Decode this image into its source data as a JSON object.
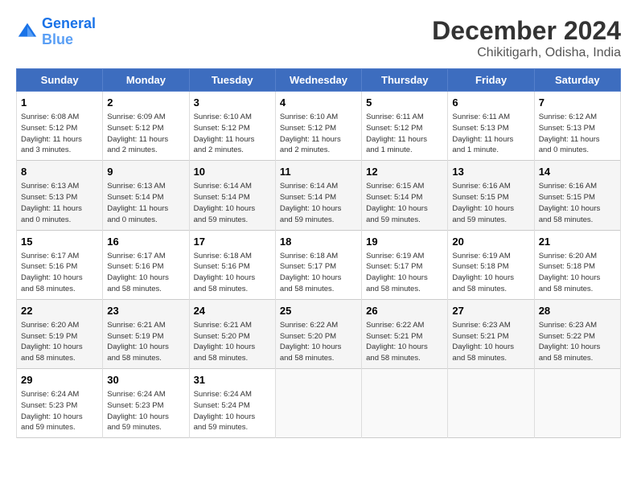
{
  "logo": {
    "line1": "General",
    "line2": "Blue"
  },
  "title": "December 2024",
  "subtitle": "Chikitigarh, Odisha, India",
  "weekdays": [
    "Sunday",
    "Monday",
    "Tuesday",
    "Wednesday",
    "Thursday",
    "Friday",
    "Saturday"
  ],
  "weeks": [
    [
      {
        "day": 1,
        "info": "Sunrise: 6:08 AM\nSunset: 5:12 PM\nDaylight: 11 hours\nand 3 minutes."
      },
      {
        "day": 2,
        "info": "Sunrise: 6:09 AM\nSunset: 5:12 PM\nDaylight: 11 hours\nand 2 minutes."
      },
      {
        "day": 3,
        "info": "Sunrise: 6:10 AM\nSunset: 5:12 PM\nDaylight: 11 hours\nand 2 minutes."
      },
      {
        "day": 4,
        "info": "Sunrise: 6:10 AM\nSunset: 5:12 PM\nDaylight: 11 hours\nand 2 minutes."
      },
      {
        "day": 5,
        "info": "Sunrise: 6:11 AM\nSunset: 5:12 PM\nDaylight: 11 hours\nand 1 minute."
      },
      {
        "day": 6,
        "info": "Sunrise: 6:11 AM\nSunset: 5:13 PM\nDaylight: 11 hours\nand 1 minute."
      },
      {
        "day": 7,
        "info": "Sunrise: 6:12 AM\nSunset: 5:13 PM\nDaylight: 11 hours\nand 0 minutes."
      }
    ],
    [
      {
        "day": 8,
        "info": "Sunrise: 6:13 AM\nSunset: 5:13 PM\nDaylight: 11 hours\nand 0 minutes."
      },
      {
        "day": 9,
        "info": "Sunrise: 6:13 AM\nSunset: 5:14 PM\nDaylight: 11 hours\nand 0 minutes."
      },
      {
        "day": 10,
        "info": "Sunrise: 6:14 AM\nSunset: 5:14 PM\nDaylight: 10 hours\nand 59 minutes."
      },
      {
        "day": 11,
        "info": "Sunrise: 6:14 AM\nSunset: 5:14 PM\nDaylight: 10 hours\nand 59 minutes."
      },
      {
        "day": 12,
        "info": "Sunrise: 6:15 AM\nSunset: 5:14 PM\nDaylight: 10 hours\nand 59 minutes."
      },
      {
        "day": 13,
        "info": "Sunrise: 6:16 AM\nSunset: 5:15 PM\nDaylight: 10 hours\nand 59 minutes."
      },
      {
        "day": 14,
        "info": "Sunrise: 6:16 AM\nSunset: 5:15 PM\nDaylight: 10 hours\nand 58 minutes."
      }
    ],
    [
      {
        "day": 15,
        "info": "Sunrise: 6:17 AM\nSunset: 5:16 PM\nDaylight: 10 hours\nand 58 minutes."
      },
      {
        "day": 16,
        "info": "Sunrise: 6:17 AM\nSunset: 5:16 PM\nDaylight: 10 hours\nand 58 minutes."
      },
      {
        "day": 17,
        "info": "Sunrise: 6:18 AM\nSunset: 5:16 PM\nDaylight: 10 hours\nand 58 minutes."
      },
      {
        "day": 18,
        "info": "Sunrise: 6:18 AM\nSunset: 5:17 PM\nDaylight: 10 hours\nand 58 minutes."
      },
      {
        "day": 19,
        "info": "Sunrise: 6:19 AM\nSunset: 5:17 PM\nDaylight: 10 hours\nand 58 minutes."
      },
      {
        "day": 20,
        "info": "Sunrise: 6:19 AM\nSunset: 5:18 PM\nDaylight: 10 hours\nand 58 minutes."
      },
      {
        "day": 21,
        "info": "Sunrise: 6:20 AM\nSunset: 5:18 PM\nDaylight: 10 hours\nand 58 minutes."
      }
    ],
    [
      {
        "day": 22,
        "info": "Sunrise: 6:20 AM\nSunset: 5:19 PM\nDaylight: 10 hours\nand 58 minutes."
      },
      {
        "day": 23,
        "info": "Sunrise: 6:21 AM\nSunset: 5:19 PM\nDaylight: 10 hours\nand 58 minutes."
      },
      {
        "day": 24,
        "info": "Sunrise: 6:21 AM\nSunset: 5:20 PM\nDaylight: 10 hours\nand 58 minutes."
      },
      {
        "day": 25,
        "info": "Sunrise: 6:22 AM\nSunset: 5:20 PM\nDaylight: 10 hours\nand 58 minutes."
      },
      {
        "day": 26,
        "info": "Sunrise: 6:22 AM\nSunset: 5:21 PM\nDaylight: 10 hours\nand 58 minutes."
      },
      {
        "day": 27,
        "info": "Sunrise: 6:23 AM\nSunset: 5:21 PM\nDaylight: 10 hours\nand 58 minutes."
      },
      {
        "day": 28,
        "info": "Sunrise: 6:23 AM\nSunset: 5:22 PM\nDaylight: 10 hours\nand 58 minutes."
      }
    ],
    [
      {
        "day": 29,
        "info": "Sunrise: 6:24 AM\nSunset: 5:23 PM\nDaylight: 10 hours\nand 59 minutes."
      },
      {
        "day": 30,
        "info": "Sunrise: 6:24 AM\nSunset: 5:23 PM\nDaylight: 10 hours\nand 59 minutes."
      },
      {
        "day": 31,
        "info": "Sunrise: 6:24 AM\nSunset: 5:24 PM\nDaylight: 10 hours\nand 59 minutes."
      },
      null,
      null,
      null,
      null
    ]
  ]
}
